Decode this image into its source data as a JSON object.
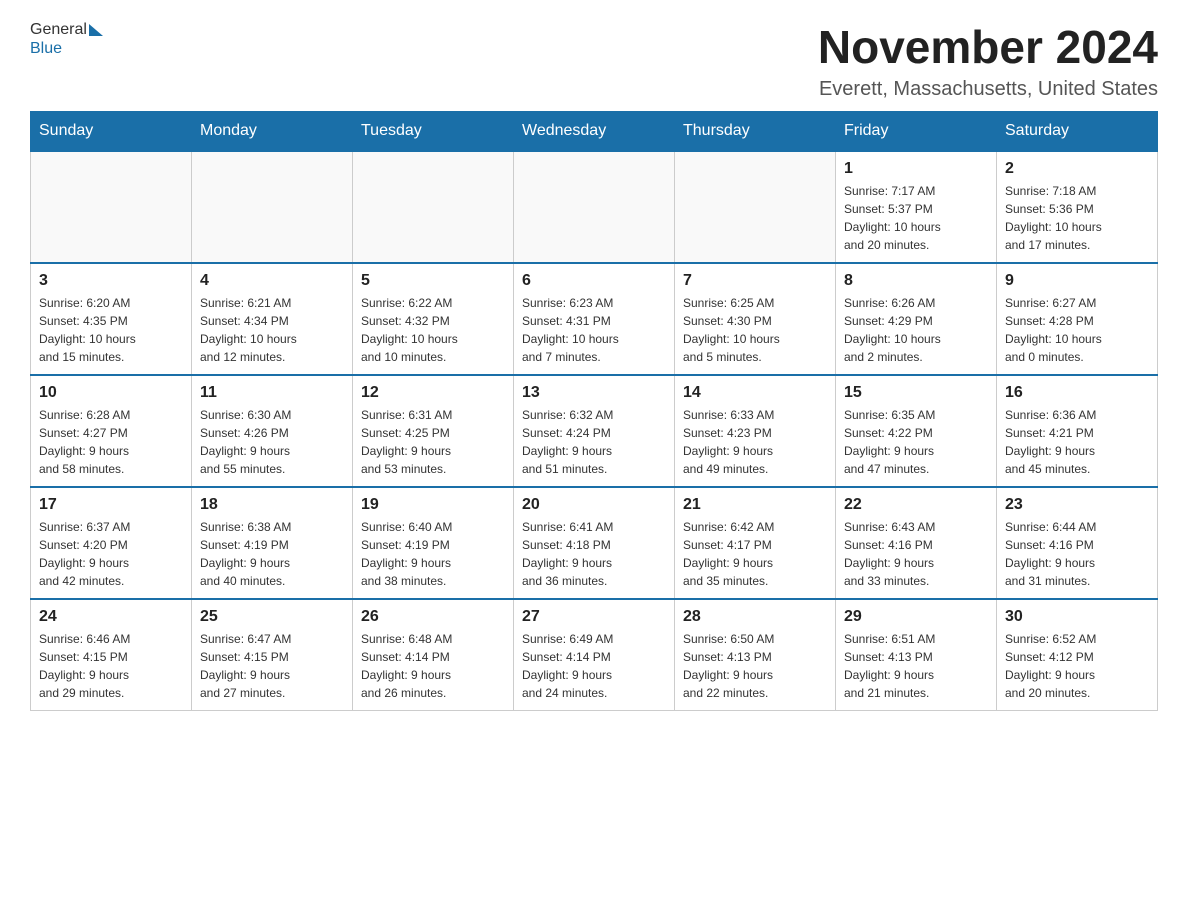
{
  "header": {
    "logo_general": "General",
    "logo_blue": "Blue",
    "title": "November 2024",
    "subtitle": "Everett, Massachusetts, United States"
  },
  "days_of_week": [
    "Sunday",
    "Monday",
    "Tuesday",
    "Wednesday",
    "Thursday",
    "Friday",
    "Saturday"
  ],
  "weeks": [
    {
      "days": [
        {
          "number": "",
          "info": ""
        },
        {
          "number": "",
          "info": ""
        },
        {
          "number": "",
          "info": ""
        },
        {
          "number": "",
          "info": ""
        },
        {
          "number": "",
          "info": ""
        },
        {
          "number": "1",
          "info": "Sunrise: 7:17 AM\nSunset: 5:37 PM\nDaylight: 10 hours\nand 20 minutes."
        },
        {
          "number": "2",
          "info": "Sunrise: 7:18 AM\nSunset: 5:36 PM\nDaylight: 10 hours\nand 17 minutes."
        }
      ]
    },
    {
      "days": [
        {
          "number": "3",
          "info": "Sunrise: 6:20 AM\nSunset: 4:35 PM\nDaylight: 10 hours\nand 15 minutes."
        },
        {
          "number": "4",
          "info": "Sunrise: 6:21 AM\nSunset: 4:34 PM\nDaylight: 10 hours\nand 12 minutes."
        },
        {
          "number": "5",
          "info": "Sunrise: 6:22 AM\nSunset: 4:32 PM\nDaylight: 10 hours\nand 10 minutes."
        },
        {
          "number": "6",
          "info": "Sunrise: 6:23 AM\nSunset: 4:31 PM\nDaylight: 10 hours\nand 7 minutes."
        },
        {
          "number": "7",
          "info": "Sunrise: 6:25 AM\nSunset: 4:30 PM\nDaylight: 10 hours\nand 5 minutes."
        },
        {
          "number": "8",
          "info": "Sunrise: 6:26 AM\nSunset: 4:29 PM\nDaylight: 10 hours\nand 2 minutes."
        },
        {
          "number": "9",
          "info": "Sunrise: 6:27 AM\nSunset: 4:28 PM\nDaylight: 10 hours\nand 0 minutes."
        }
      ]
    },
    {
      "days": [
        {
          "number": "10",
          "info": "Sunrise: 6:28 AM\nSunset: 4:27 PM\nDaylight: 9 hours\nand 58 minutes."
        },
        {
          "number": "11",
          "info": "Sunrise: 6:30 AM\nSunset: 4:26 PM\nDaylight: 9 hours\nand 55 minutes."
        },
        {
          "number": "12",
          "info": "Sunrise: 6:31 AM\nSunset: 4:25 PM\nDaylight: 9 hours\nand 53 minutes."
        },
        {
          "number": "13",
          "info": "Sunrise: 6:32 AM\nSunset: 4:24 PM\nDaylight: 9 hours\nand 51 minutes."
        },
        {
          "number": "14",
          "info": "Sunrise: 6:33 AM\nSunset: 4:23 PM\nDaylight: 9 hours\nand 49 minutes."
        },
        {
          "number": "15",
          "info": "Sunrise: 6:35 AM\nSunset: 4:22 PM\nDaylight: 9 hours\nand 47 minutes."
        },
        {
          "number": "16",
          "info": "Sunrise: 6:36 AM\nSunset: 4:21 PM\nDaylight: 9 hours\nand 45 minutes."
        }
      ]
    },
    {
      "days": [
        {
          "number": "17",
          "info": "Sunrise: 6:37 AM\nSunset: 4:20 PM\nDaylight: 9 hours\nand 42 minutes."
        },
        {
          "number": "18",
          "info": "Sunrise: 6:38 AM\nSunset: 4:19 PM\nDaylight: 9 hours\nand 40 minutes."
        },
        {
          "number": "19",
          "info": "Sunrise: 6:40 AM\nSunset: 4:19 PM\nDaylight: 9 hours\nand 38 minutes."
        },
        {
          "number": "20",
          "info": "Sunrise: 6:41 AM\nSunset: 4:18 PM\nDaylight: 9 hours\nand 36 minutes."
        },
        {
          "number": "21",
          "info": "Sunrise: 6:42 AM\nSunset: 4:17 PM\nDaylight: 9 hours\nand 35 minutes."
        },
        {
          "number": "22",
          "info": "Sunrise: 6:43 AM\nSunset: 4:16 PM\nDaylight: 9 hours\nand 33 minutes."
        },
        {
          "number": "23",
          "info": "Sunrise: 6:44 AM\nSunset: 4:16 PM\nDaylight: 9 hours\nand 31 minutes."
        }
      ]
    },
    {
      "days": [
        {
          "number": "24",
          "info": "Sunrise: 6:46 AM\nSunset: 4:15 PM\nDaylight: 9 hours\nand 29 minutes."
        },
        {
          "number": "25",
          "info": "Sunrise: 6:47 AM\nSunset: 4:15 PM\nDaylight: 9 hours\nand 27 minutes."
        },
        {
          "number": "26",
          "info": "Sunrise: 6:48 AM\nSunset: 4:14 PM\nDaylight: 9 hours\nand 26 minutes."
        },
        {
          "number": "27",
          "info": "Sunrise: 6:49 AM\nSunset: 4:14 PM\nDaylight: 9 hours\nand 24 minutes."
        },
        {
          "number": "28",
          "info": "Sunrise: 6:50 AM\nSunset: 4:13 PM\nDaylight: 9 hours\nand 22 minutes."
        },
        {
          "number": "29",
          "info": "Sunrise: 6:51 AM\nSunset: 4:13 PM\nDaylight: 9 hours\nand 21 minutes."
        },
        {
          "number": "30",
          "info": "Sunrise: 6:52 AM\nSunset: 4:12 PM\nDaylight: 9 hours\nand 20 minutes."
        }
      ]
    }
  ]
}
